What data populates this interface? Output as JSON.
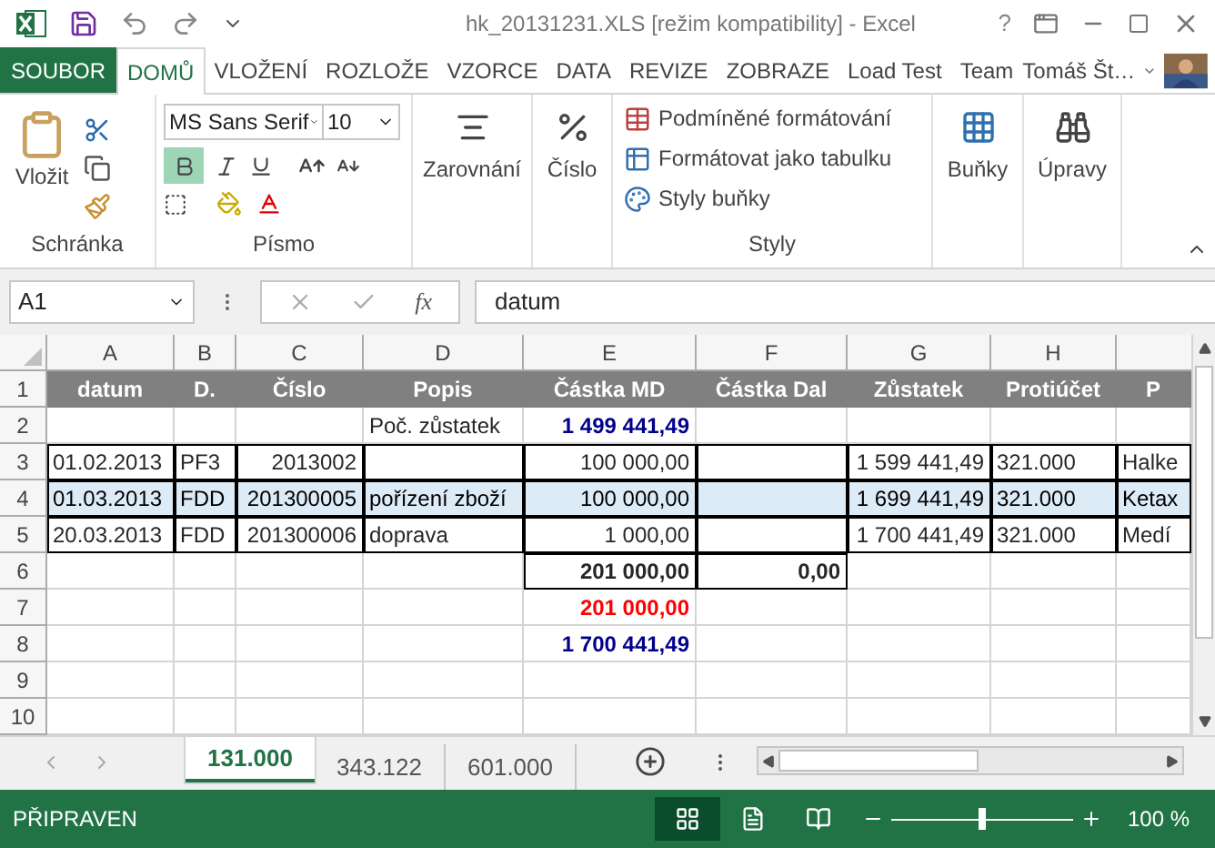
{
  "window": {
    "title": "hk_20131231.XLS  [režim kompatibility] - Excel",
    "help": "?"
  },
  "ribbon_tabs": [
    {
      "label": "SOUBOR",
      "kind": "file",
      "selected": false
    },
    {
      "label": "DOMŮ",
      "kind": "tab",
      "selected": true
    },
    {
      "label": "VLOŽENÍ",
      "kind": "tab",
      "selected": false
    },
    {
      "label": "ROZLOŽE",
      "kind": "tab",
      "selected": false
    },
    {
      "label": "VZORCE",
      "kind": "tab",
      "selected": false
    },
    {
      "label": "DATA",
      "kind": "tab",
      "selected": false
    },
    {
      "label": "REVIZE",
      "kind": "tab",
      "selected": false
    },
    {
      "label": "ZOBRAZE",
      "kind": "tab",
      "selected": false
    },
    {
      "label": "Load Test",
      "kind": "tab",
      "selected": false
    },
    {
      "label": "Team",
      "kind": "tab",
      "selected": false
    }
  ],
  "user": {
    "name": "Tomáš Št…"
  },
  "ribbon": {
    "clipboard": {
      "paste": "Vložit",
      "label": "Schránka"
    },
    "font": {
      "name": "MS Sans Serif",
      "size": "10",
      "bold": true,
      "label": "Písmo"
    },
    "alignment": "Zarovnání",
    "number": "Číslo",
    "styles": {
      "items": [
        "Podmíněné formátování",
        "Formátovat jako tabulku",
        "Styly buňky"
      ],
      "label": "Styly"
    },
    "cells": "Buňky",
    "editing": "Úpravy"
  },
  "formula_bar": {
    "name_box": "A1",
    "fx": "fx",
    "value": "datum"
  },
  "sheet": {
    "columns": [
      "A",
      "B",
      "C",
      "D",
      "E",
      "F",
      "G",
      "H"
    ],
    "rows": [
      {
        "number": "1",
        "highlighted": false,
        "cells": [
          {
            "kind": "header",
            "text": "datum"
          },
          {
            "kind": "header",
            "text": "D."
          },
          {
            "kind": "header",
            "text": "Číslo"
          },
          {
            "kind": "header",
            "text": "Popis"
          },
          {
            "kind": "header",
            "text": "Částka MD"
          },
          {
            "kind": "header",
            "text": "Částka Dal"
          },
          {
            "kind": "header",
            "text": "Zůstatek"
          },
          {
            "kind": "header",
            "text": "Protiúčet"
          },
          {
            "kind": "header",
            "text": "P"
          }
        ]
      },
      {
        "number": "2",
        "highlighted": false,
        "cells": [
          {
            "kind": "empty"
          },
          {
            "kind": "empty"
          },
          {
            "kind": "empty"
          },
          {
            "kind": "text",
            "text": "Poč. zůstatek"
          },
          {
            "kind": "blue",
            "text": "1 499 441,49"
          },
          {
            "kind": "empty"
          },
          {
            "kind": "empty"
          },
          {
            "kind": "empty"
          },
          {
            "kind": "empty"
          }
        ]
      },
      {
        "number": "3",
        "highlighted": false,
        "cells": [
          {
            "kind": "frame",
            "text": "01.02.2013"
          },
          {
            "kind": "frame",
            "text": "PF3"
          },
          {
            "kind": "framenum",
            "text": "2013002"
          },
          {
            "kind": "frame"
          },
          {
            "kind": "framenum",
            "text": "100 000,00"
          },
          {
            "kind": "frame"
          },
          {
            "kind": "framenum",
            "text": "1 599 441,49"
          },
          {
            "kind": "frame",
            "text": "321.000"
          },
          {
            "kind": "frame",
            "text": "Halke"
          }
        ]
      },
      {
        "number": "4",
        "highlighted": true,
        "cells": [
          {
            "kind": "frame",
            "text": "01.03.2013"
          },
          {
            "kind": "frame",
            "text": "FDD"
          },
          {
            "kind": "framenum",
            "text": "201300005"
          },
          {
            "kind": "frame",
            "text": "pořízení zboží"
          },
          {
            "kind": "framenum",
            "text": "100 000,00"
          },
          {
            "kind": "frame"
          },
          {
            "kind": "framenum",
            "text": "1 699 441,49"
          },
          {
            "kind": "frame",
            "text": "321.000"
          },
          {
            "kind": "frame",
            "text": "Ketax"
          }
        ]
      },
      {
        "number": "5",
        "highlighted": false,
        "cells": [
          {
            "kind": "frame",
            "text": "20.03.2013"
          },
          {
            "kind": "frame",
            "text": "FDD"
          },
          {
            "kind": "framenum",
            "text": "201300006"
          },
          {
            "kind": "frame",
            "text": "doprava"
          },
          {
            "kind": "framenum",
            "text": "1 000,00"
          },
          {
            "kind": "frame"
          },
          {
            "kind": "framenum",
            "text": "1 700 441,49"
          },
          {
            "kind": "frame",
            "text": "321.000"
          },
          {
            "kind": "frame",
            "text": "Medí"
          }
        ]
      },
      {
        "number": "6",
        "highlighted": false,
        "cells": [
          {
            "kind": "empty"
          },
          {
            "kind": "empty"
          },
          {
            "kind": "empty"
          },
          {
            "kind": "empty"
          },
          {
            "kind": "total",
            "text": "201 000,00"
          },
          {
            "kind": "total",
            "text": "0,00"
          },
          {
            "kind": "empty"
          },
          {
            "kind": "empty"
          },
          {
            "kind": "empty"
          }
        ]
      },
      {
        "number": "7",
        "highlighted": false,
        "cells": [
          {
            "kind": "empty"
          },
          {
            "kind": "empty"
          },
          {
            "kind": "empty"
          },
          {
            "kind": "empty"
          },
          {
            "kind": "red",
            "text": "201 000,00"
          },
          {
            "kind": "empty"
          },
          {
            "kind": "empty"
          },
          {
            "kind": "empty"
          },
          {
            "kind": "empty"
          }
        ]
      },
      {
        "number": "8",
        "highlighted": false,
        "cells": [
          {
            "kind": "empty"
          },
          {
            "kind": "empty"
          },
          {
            "kind": "empty"
          },
          {
            "kind": "empty"
          },
          {
            "kind": "blue",
            "text": "1 700 441,49"
          },
          {
            "kind": "empty"
          },
          {
            "kind": "empty"
          },
          {
            "kind": "empty"
          },
          {
            "kind": "empty"
          }
        ]
      },
      {
        "number": "9",
        "highlighted": false,
        "cells": [
          {
            "kind": "empty"
          },
          {
            "kind": "empty"
          },
          {
            "kind": "empty"
          },
          {
            "kind": "empty"
          },
          {
            "kind": "empty"
          },
          {
            "kind": "empty"
          },
          {
            "kind": "empty"
          },
          {
            "kind": "empty"
          },
          {
            "kind": "empty"
          }
        ]
      },
      {
        "number": "10",
        "highlighted": false,
        "cells": [
          {
            "kind": "empty"
          },
          {
            "kind": "empty"
          },
          {
            "kind": "empty"
          },
          {
            "kind": "empty"
          },
          {
            "kind": "empty"
          },
          {
            "kind": "empty"
          },
          {
            "kind": "empty"
          },
          {
            "kind": "empty"
          },
          {
            "kind": "empty"
          }
        ]
      }
    ]
  },
  "sheet_tabs": [
    {
      "label": "131.000",
      "selected": true
    },
    {
      "label": "343.122",
      "selected": false
    },
    {
      "label": "601.000",
      "selected": false
    }
  ],
  "status_bar": {
    "text": "PŘIPRAVEN",
    "views": [
      {
        "kind": "normal",
        "selected": true
      },
      {
        "kind": "layout",
        "selected": false
      },
      {
        "kind": "pagebreak",
        "selected": false
      }
    ],
    "level": 0.5,
    "zoom": "100 %"
  }
}
